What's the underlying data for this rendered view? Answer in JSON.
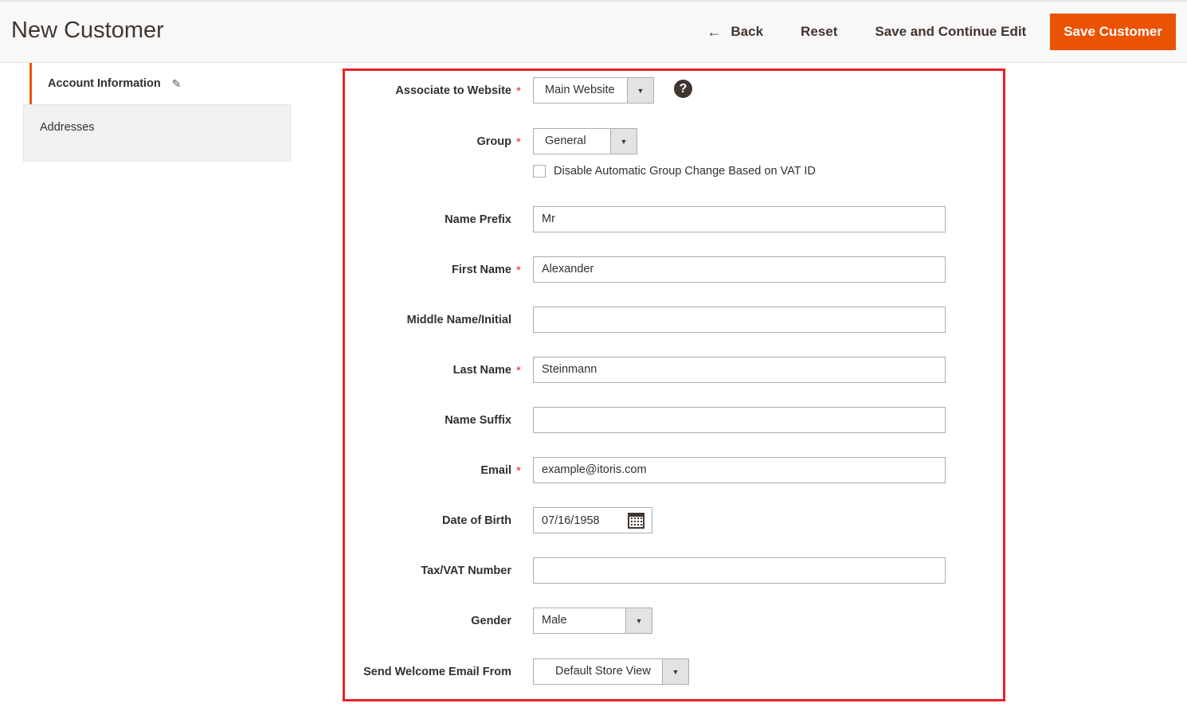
{
  "header": {
    "title": "New Customer",
    "back_label": "Back",
    "reset_label": "Reset",
    "save_continue_label": "Save and Continue Edit",
    "save_label": "Save Customer"
  },
  "sidebar": {
    "items": [
      {
        "label": "Account Information",
        "active": true
      },
      {
        "label": "Addresses",
        "active": false
      }
    ]
  },
  "form": {
    "website": {
      "label": "Associate to Website",
      "required": true,
      "value": "Main Website"
    },
    "group": {
      "label": "Group",
      "required": true,
      "value": "General"
    },
    "disable_group_change": {
      "label": "Disable Automatic Group Change Based on VAT ID",
      "checked": false
    },
    "prefix": {
      "label": "Name Prefix",
      "value": "Mr"
    },
    "first_name": {
      "label": "First Name",
      "required": true,
      "value": "Alexander"
    },
    "middle_name": {
      "label": "Middle Name/Initial",
      "value": ""
    },
    "last_name": {
      "label": "Last Name",
      "required": true,
      "value": "Steinmann"
    },
    "suffix": {
      "label": "Name Suffix",
      "value": ""
    },
    "email": {
      "label": "Email",
      "required": true,
      "value": "example@itoris.com"
    },
    "dob": {
      "label": "Date of Birth",
      "value": "07/16/1958"
    },
    "taxvat": {
      "label": "Tax/VAT Number",
      "value": ""
    },
    "gender": {
      "label": "Gender",
      "value": "Male"
    },
    "send_email": {
      "label": "Send Welcome Email From",
      "value": "Default Store View"
    }
  },
  "colors": {
    "accent": "#eb5202",
    "highlight_frame": "#e8202a",
    "required": "#e22626"
  }
}
